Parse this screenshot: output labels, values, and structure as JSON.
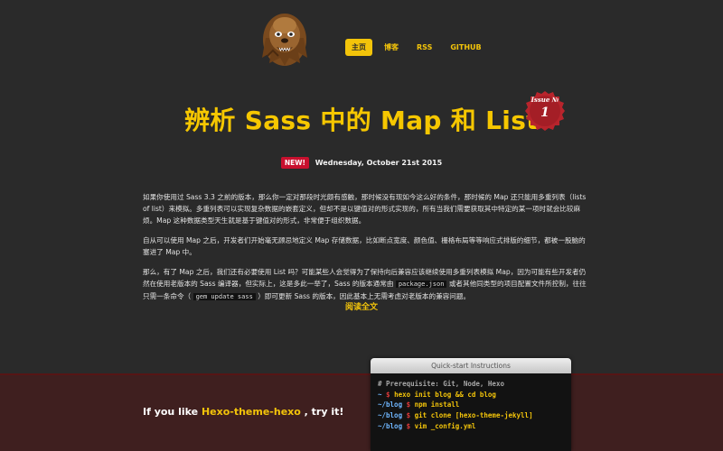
{
  "header": {
    "nav": [
      {
        "label": "主页",
        "active": true
      },
      {
        "label": "博客",
        "active": false
      },
      {
        "label": "RSS",
        "active": false
      },
      {
        "label": "GITHUB",
        "active": false
      }
    ]
  },
  "post": {
    "title": "辨析 Sass 中的 Map 和 List",
    "issue_label": "Issue №",
    "issue_number": "1",
    "new_badge": "NEW!",
    "date": "Wednesday, October 21st 2015",
    "p1": "如果你使用过 Sass 3.3 之前的版本，那么你一定对那段时光颇有感触，那时候没有现如今这么好的条件，那时候的 Map 还只能用多重列表（lists of list）来模拟。多重列表可以实现复杂数据的嵌套定义，但却不是以键值对的形式实现的，所有当我们需要获取其中特定的某一项时就会比较麻烦。Map 这种数据类型天生就是基于键值对的形式，非常便于组织数据。",
    "p2": "自从可以使用 Map 之后，开发者们开始毫无顾忌地定义 Map 存储数据，比如断点宽度、颜色值、栅格布局等等响应式排版的细节，都被一股脑的塞进了 Map 中。",
    "p3": {
      "a": "那么，有了 Map 之后，我们还有必要使用 List 吗？可能某些人会觉得为了保持向后兼容应该继续使用多重列表模拟 Map，因为可能有些开发者仍然在使用老版本的 Sass 编译器，但实际上，这是多此一举了，Sass 的版本通常由",
      "code1": "package.json",
      "b": "或者其他同类型的项目配置文件所控制，往往只需一条命令（",
      "code2": "gem update sass",
      "c": "）即可更新 Sass 的版本，因此基本上无需考虑对老版本的兼容问题。"
    },
    "read_more": "阅读全文"
  },
  "footer": {
    "try_prefix": "If you like ",
    "try_link": "Hexo-theme-hexo",
    "try_suffix": " , try it!",
    "terminal": {
      "title": "Quick-start Instructions",
      "comment": "# Prerequisite: Git, Node, Hexo",
      "lines": [
        {
          "path": "~",
          "cmd": "hexo init blog && cd blog"
        },
        {
          "path": "~/blog",
          "cmd": "npm install"
        },
        {
          "path": "~/blog",
          "cmd": "git clone [hexo-theme-jekyll]"
        },
        {
          "path": "~/blog",
          "cmd": "vim _config.yml"
        }
      ]
    }
  },
  "colors": {
    "accent": "#f3c40a",
    "background": "#2a2a2a",
    "footer": "#3f1f1f",
    "new_badge": "#c8102e",
    "issue_badge": "#b8242c"
  },
  "icons": {
    "logo": "chewbacca-avatar"
  }
}
